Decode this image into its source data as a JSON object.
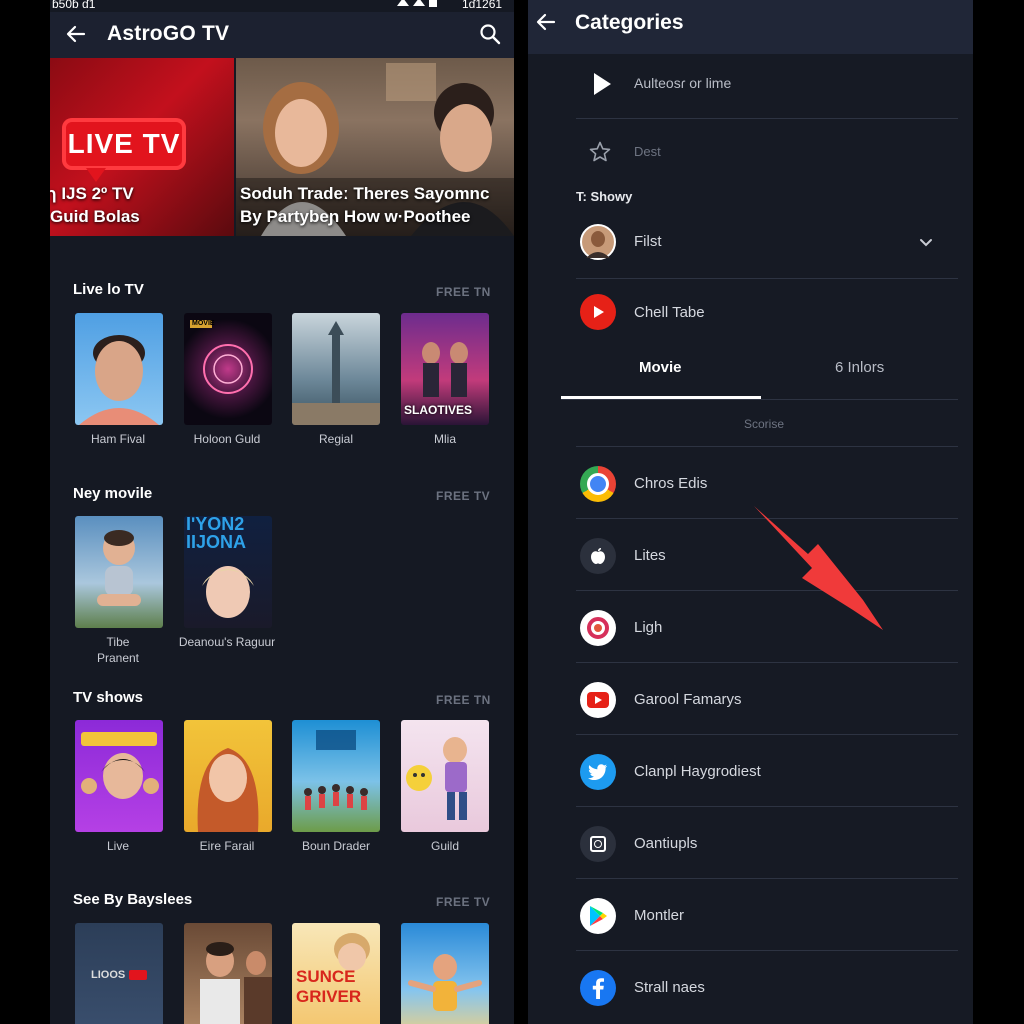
{
  "status": {
    "left_text": "ɓ50ɓ ɗ1",
    "right_text": "1ɗ1261"
  },
  "app": {
    "title": "AstroGO TV"
  },
  "hero": {
    "live_badge": "LIVE TV",
    "caption_left_1": "ɿ IJS 2º TV",
    "caption_left_2": "Guid Bolas",
    "caption_right_1": "Soduh Tradeː Theres Sayomnc",
    "caption_right_2": "By Partybeɲ How w·Poothee"
  },
  "sections": [
    {
      "title": "Live lo TV",
      "tag": "FREE TN",
      "items": [
        {
          "label": "Ham Fival"
        },
        {
          "label": "Holoon Guld"
        },
        {
          "label": "Regial"
        },
        {
          "label": "Mlia"
        }
      ]
    },
    {
      "title": "Ney movile",
      "tag": "FREE TV",
      "items": [
        {
          "label": "Tibe\nPranent"
        },
        {
          "label": "Deanoɯ's Raguur"
        }
      ]
    },
    {
      "title": "TV shows",
      "tag": "FREE TN",
      "items": [
        {
          "label": "Live"
        },
        {
          "label": "Eire Farail"
        },
        {
          "label": "Boun Drader"
        },
        {
          "label": "Guild"
        }
      ]
    },
    {
      "title": "See By Bayslees",
      "tag": "FREE TV",
      "items": [
        {
          "label": ""
        },
        {
          "label": ""
        },
        {
          "label": ""
        },
        {
          "label": ""
        }
      ]
    }
  ],
  "poster_text": {
    "galaxy_top": "MOVIE",
    "slaotives": "SLAOTIVES",
    "ityon": "IʹYON2\nIIJONA",
    "sunce": "SUNCE\nGRIVER",
    "lioos": "LIOOS"
  },
  "categories": {
    "title": "Categories",
    "top_rows": [
      {
        "label": "Aulteosɾ or lime"
      },
      {
        "label": "Dest"
      }
    ],
    "subheader": "T: Showy",
    "rows_mid": [
      {
        "label": "Filst"
      },
      {
        "label": "Chell Tabe"
      }
    ],
    "tabs": [
      {
        "label": "Movie",
        "active": true
      },
      {
        "label": "6 Inlors",
        "active": false
      }
    ],
    "sub_label": "Scorise",
    "app_rows": [
      {
        "label": "Chros Edis",
        "icon": "chrome-icon"
      },
      {
        "label": "Lites",
        "icon": "apple-icon"
      },
      {
        "label": "Ligh",
        "icon": "instagram-icon"
      },
      {
        "label": "Garool Famarys",
        "icon": "youtube-icon"
      },
      {
        "label": "Clanpl Haygrodiest",
        "icon": "twitter-icon"
      },
      {
        "label": "Oantiupls",
        "icon": "camera-icon"
      },
      {
        "label": "Montler",
        "icon": "play-store-icon"
      },
      {
        "label": "Strall naes",
        "icon": "facebook-icon"
      }
    ]
  },
  "colors": {
    "accent_red": "#e2141d",
    "bg": "#151923",
    "arrow": "#f03a3a"
  }
}
